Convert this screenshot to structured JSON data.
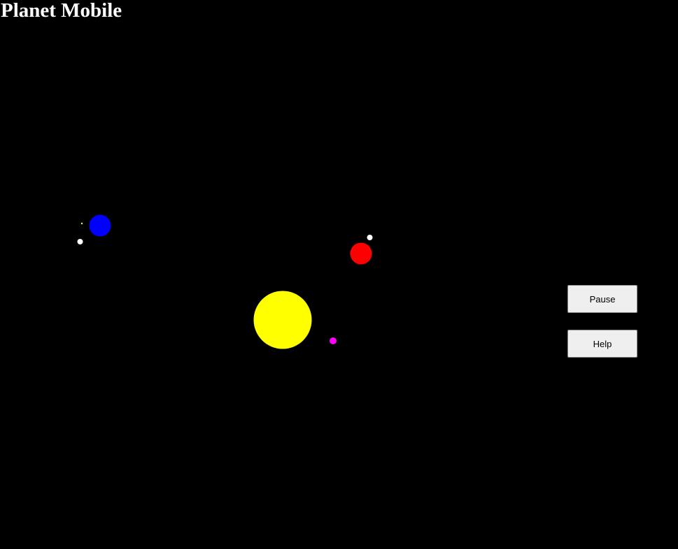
{
  "title": "Planet Mobile",
  "controls": {
    "pause_label": "Pause",
    "help_label": "Help"
  },
  "colors": {
    "background": "#000000",
    "sun": "#ffff00",
    "blue_planet": "#0000ff",
    "red_planet": "#ff0000",
    "magenta_planet": "#ff00ff",
    "moon": "#ffffff",
    "small_yellow_moon": "#ffff00"
  },
  "bodies": [
    {
      "name": "sun",
      "color": "#ffff00"
    },
    {
      "name": "blue-planet",
      "color": "#0000ff"
    },
    {
      "name": "blue-planet-moon",
      "color": "#ffffff"
    },
    {
      "name": "blue-planet-small-moon",
      "color": "#ffff00"
    },
    {
      "name": "red-planet",
      "color": "#ff0000"
    },
    {
      "name": "red-planet-moon",
      "color": "#ffffff"
    },
    {
      "name": "magenta-planet",
      "color": "#ff00ff"
    }
  ]
}
